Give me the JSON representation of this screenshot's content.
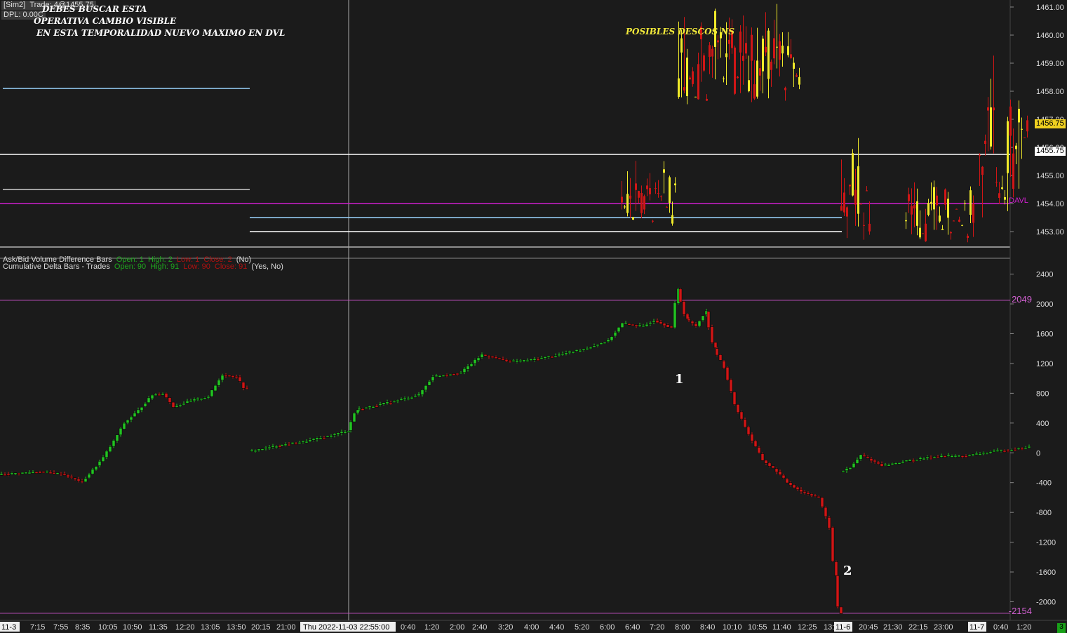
{
  "account": {
    "sim": "[Sim2]",
    "trade": "Trade: 4@1455.75",
    "dpl": "DPL: 0.00C"
  },
  "annotations": {
    "line1": "DEBES BUSCAR ESTA",
    "line2": "OPERATIVA CAMBIO VISIBLE",
    "line3": "EN ESTA TEMPORALIDAD  NUEVO MAXIMO EN DVL",
    "posibles": "POSIBLES DESCOS NS",
    "marker1": "1",
    "marker2": "2"
  },
  "indicators": {
    "askbid": {
      "name": "Ask/Bid Volume Difference Bars",
      "open": "Open: 1",
      "high": "High: 2",
      "low": "Low: 1",
      "close": "Close: 2",
      "params": "(No)"
    },
    "cumdelta": {
      "name": "Cumulative Delta Bars - Trades",
      "open": "Open: 90",
      "high": "High: 91",
      "low": "Low: 90",
      "close": "Close: 91",
      "params": "(Yes, No)"
    }
  },
  "price_boxes": {
    "last": "1456.75",
    "trade": "1455.75",
    "dvl": "DAVL"
  },
  "levels": {
    "top": "2049",
    "bottom": "-2154"
  },
  "colors": {
    "bg": "#1b1b1b",
    "up": "#22c422",
    "down": "#d01616",
    "yellow": "#f0ea2a",
    "magenta": "#d020d0",
    "level": "#c050c0"
  },
  "chart_data": [
    {
      "type": "bar",
      "title": "Price",
      "ylim": [
        1452.5,
        1461.2
      ],
      "y_ticks": [
        "1461.00",
        "1460.00",
        "1459.00",
        "1458.00",
        "1457.00",
        "1456.00",
        "1455.00",
        "1454.00",
        "1453.00"
      ],
      "horizontal_levels": [
        {
          "price": 1455.75,
          "color": "#ffffff"
        },
        {
          "price": 1454.0,
          "color": "#d020d0"
        }
      ]
    },
    {
      "type": "bar",
      "title": "Cumulative Delta Bars - Trades",
      "ylim": [
        -2250,
        2500
      ],
      "y_ticks": [
        "2400",
        "2000",
        "1600",
        "1200",
        "800",
        "400",
        "0",
        "-400",
        "-800",
        "-1200",
        "-1600",
        "-2000"
      ],
      "levels": [
        2049,
        -2154
      ],
      "path": [
        [
          0,
          -290
        ],
        [
          30,
          -270
        ],
        [
          60,
          -250
        ],
        [
          90,
          -280
        ],
        [
          120,
          -390
        ],
        [
          135,
          -230
        ],
        [
          150,
          -60
        ],
        [
          165,
          160
        ],
        [
          180,
          400
        ],
        [
          200,
          570
        ],
        [
          220,
          780
        ],
        [
          235,
          800
        ],
        [
          250,
          620
        ],
        [
          275,
          700
        ],
        [
          300,
          760
        ],
        [
          320,
          1050
        ],
        [
          340,
          1020
        ],
        [
          352,
          850
        ],
        null,
        [
          357,
          20
        ],
        [
          400,
          100
        ],
        [
          440,
          160
        ],
        [
          470,
          220
        ],
        [
          498,
          300
        ],
        [
          510,
          580
        ],
        [
          540,
          640
        ],
        [
          580,
          730
        ],
        [
          600,
          780
        ],
        [
          620,
          1030
        ],
        [
          660,
          1080
        ],
        [
          690,
          1320
        ],
        [
          730,
          1230
        ],
        [
          760,
          1250
        ],
        [
          800,
          1320
        ],
        [
          840,
          1410
        ],
        [
          870,
          1510
        ],
        [
          890,
          1740
        ],
        [
          920,
          1700
        ],
        [
          935,
          1780
        ],
        [
          960,
          1680
        ],
        [
          968,
          2200
        ],
        [
          980,
          1800
        ],
        [
          995,
          1700
        ],
        [
          1008,
          1900
        ],
        [
          1020,
          1400
        ],
        [
          1035,
          1150
        ],
        [
          1050,
          650
        ],
        [
          1070,
          250
        ],
        [
          1090,
          -100
        ],
        [
          1110,
          -250
        ],
        [
          1125,
          -400
        ],
        [
          1145,
          -520
        ],
        [
          1170,
          -600
        ],
        [
          1185,
          -1000
        ],
        [
          1192,
          -1650
        ],
        [
          1198,
          -2154
        ],
        null,
        [
          1200,
          -260
        ],
        [
          1215,
          -200
        ],
        [
          1230,
          -30
        ],
        [
          1260,
          -170
        ],
        [
          1300,
          -100
        ],
        [
          1340,
          -40
        ],
        [
          1380,
          -40
        ],
        [
          1410,
          10
        ],
        [
          1440,
          40
        ],
        [
          1468,
          80
        ]
      ]
    }
  ],
  "x_axis_labels": [
    "11-3",
    "7:15",
    "7:55",
    "8:35",
    "10:05",
    "10:50",
    "11:35",
    "12:20",
    "13:05",
    "13:50",
    "20:15",
    "21:00",
    "Thu 2022-11-03  22:55:00",
    "0:40",
    "1:20",
    "2:00",
    "2:40",
    "3:20",
    "4:00",
    "4:40",
    "5:20",
    "6:00",
    "6:40",
    "7:20",
    "8:00",
    "8:40",
    "10:10",
    "10:55",
    "11:40",
    "12:25",
    "13:10",
    "11-6",
    "20:45",
    "21:30",
    "22:15",
    "23:00",
    "11-7",
    "0:40",
    "1:20"
  ],
  "footer_badge": "3"
}
